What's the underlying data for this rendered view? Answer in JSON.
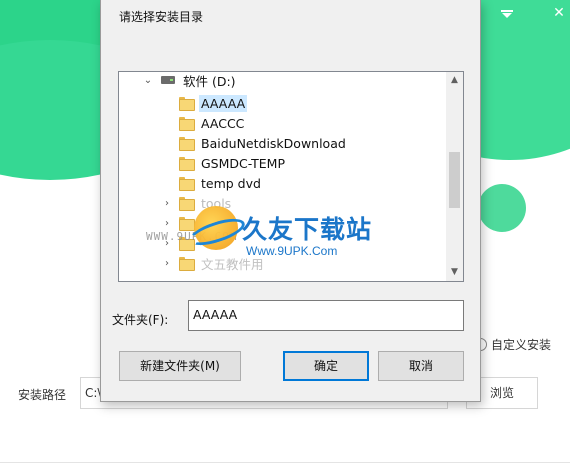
{
  "installer": {
    "custom_install_label": "自定义安装",
    "install_path_label": "安装路径",
    "install_path_value": "C:\\",
    "browse_label": "浏览",
    "minimize_icon": "minimize-to-tray-icon",
    "close_icon": "close-icon"
  },
  "dialog": {
    "title": "请选择安装目录",
    "tree": {
      "drive_label": "软件 (D:)",
      "folders": [
        "AAAAA",
        "AACCC",
        "BaiduNetdiskDownload",
        "GSMDC-TEMP",
        "temp dvd"
      ],
      "selected": "AAAAA",
      "collapsed_items": [
        "tools",
        "",
        "",
        "文五教件用"
      ]
    },
    "folder_label": "文件夹(F):",
    "folder_value": "AAAAA",
    "new_folder_label": "新建文件夹(M)",
    "ok_label": "确定",
    "cancel_label": "取消"
  },
  "watermark": {
    "left_url": "WWW.9UPK.COM",
    "brand": "久友下载站",
    "url": "Www.9UPK.Com"
  },
  "colors": {
    "brand_green": "#2cd48a",
    "selection": "#cce8ff",
    "focus_blue": "#0078d7",
    "watermark_blue": "#1b76c9"
  }
}
